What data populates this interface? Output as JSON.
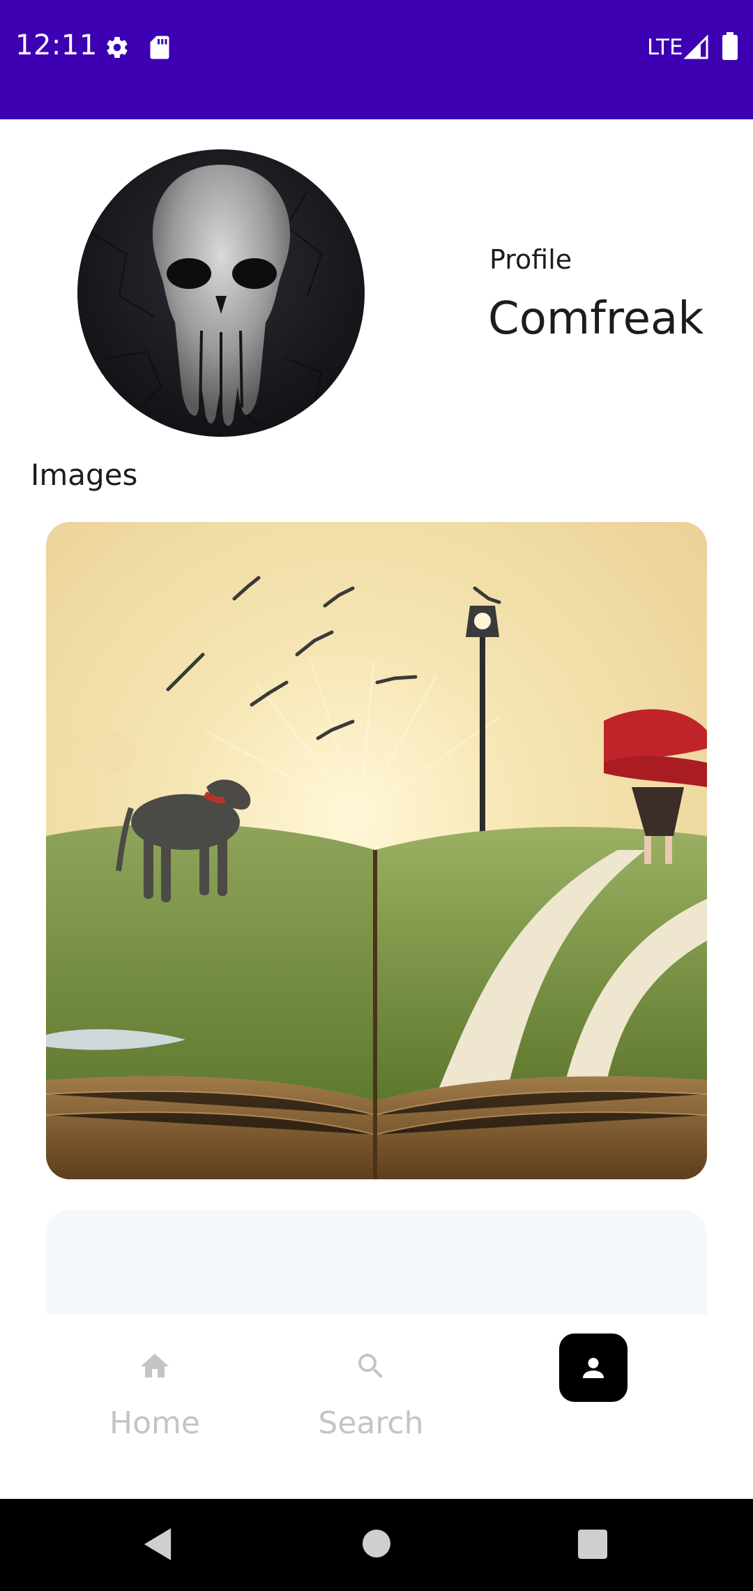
{
  "status_bar": {
    "time": "12:11",
    "network": "LTE",
    "background": "#3d00b3",
    "icons": [
      "gear-icon",
      "sd-card-icon",
      "signal-icon",
      "battery-icon"
    ]
  },
  "profile": {
    "label": "Profile",
    "name": "Comfreak",
    "avatar": "skull-avatar"
  },
  "images_section": {
    "heading": "Images",
    "items": [
      "book-landscape-image",
      "image-card-placeholder"
    ]
  },
  "bottom_nav": {
    "items": [
      {
        "label": "Home",
        "icon": "home-icon",
        "selected": false
      },
      {
        "label": "Search",
        "icon": "search-icon",
        "selected": false
      },
      {
        "label": "",
        "icon": "person-icon",
        "selected": true
      }
    ],
    "selected_color": "#000000",
    "inactive_color": "#c4c4c4"
  },
  "system_nav": {
    "buttons": [
      "back-icon",
      "home-circle-icon",
      "recents-icon"
    ]
  }
}
